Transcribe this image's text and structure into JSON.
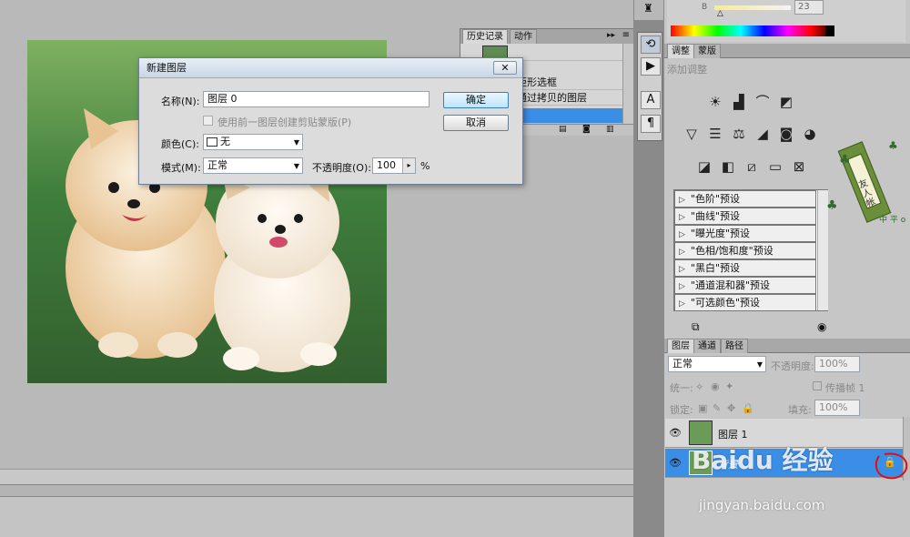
{
  "history_panel": {
    "tabs": [
      "历史记录",
      "动作"
    ],
    "items": [
      "矩形选框",
      "通过拷贝的图层",
      ""
    ]
  },
  "dialog": {
    "title": "新建图层",
    "close": "✕",
    "name_label": "名称(N):",
    "name_value": "图层 0",
    "ok": "确定",
    "cancel": "取消",
    "clipping_label": "使用前一图层创建剪贴蒙版(P)",
    "color_label": "颜色(C):",
    "color_value": "无",
    "mode_label": "模式(M):",
    "mode_value": "正常",
    "opacity_label": "不透明度(O):",
    "opacity_value": "100",
    "opacity_unit": "%"
  },
  "color_panel": {
    "slider_label": "B",
    "value": "23"
  },
  "adjustments": {
    "tabs": [
      "调整",
      "蒙版"
    ],
    "subtitle": "添加调整",
    "presets": [
      "\"色阶\"预设",
      "\"曲线\"预设",
      "\"曝光度\"预设",
      "\"色相/饱和度\"预设",
      "\"黑白\"预设",
      "\"通道混和器\"预设",
      "\"可选颜色\"预设"
    ]
  },
  "layers": {
    "tabs": [
      "图层",
      "通道",
      "路径"
    ],
    "blend_mode": "正常",
    "opacity_label": "不透明度:",
    "opacity": "100%",
    "unify_label": "统一:",
    "propagate_label": "传播帧 1",
    "lock_label": "锁定:",
    "fill_label": "填充:",
    "fill": "100%",
    "items": [
      {
        "name": "图层 1"
      },
      {
        "name": "背景"
      }
    ]
  },
  "decor": {
    "stamp_text": "友人帐",
    "stamp_sub": "中 平 o"
  },
  "watermark": {
    "brand": "Baidu 经验",
    "url": "jingyan.baidu.com"
  },
  "colors": {
    "selection_blue": "#3a8ee6",
    "annotation_red": "#e01010"
  }
}
